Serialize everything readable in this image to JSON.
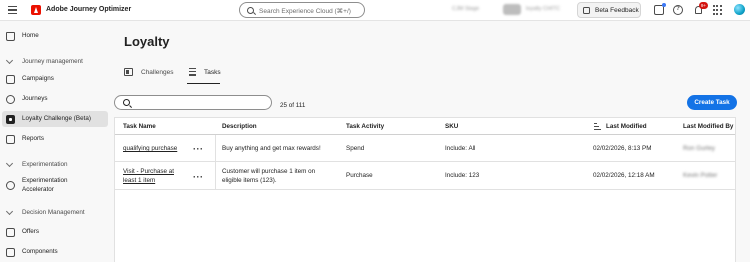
{
  "app": {
    "title": "Adobe Journey Optimizer",
    "search_placeholder": "Search Experience Cloud (⌘+/)",
    "org_sandbox_blurred": "CJM Stage",
    "org_badge_blurred": "Sbx",
    "org_name_blurred": "loyalty CHITC",
    "beta_feedback_label": "Beta Feedback",
    "notification_count": "9+",
    "accent_color": "#1473e6",
    "brand_color": "#eb1000"
  },
  "sidebar": {
    "home": "Home",
    "journey_management": "Journey management",
    "campaigns": "Campaigns",
    "journeys": "Journeys",
    "loyalty_challenge": "Loyalty Challenge (Beta)",
    "reports": "Reports",
    "experimentation": "Experimentation",
    "experimentation_accelerator": "Experimentation Accelerator",
    "decision_management": "Decision Management",
    "offers": "Offers",
    "components": "Components"
  },
  "main": {
    "page_title": "Loyalty",
    "tabs": [
      {
        "label": "Challenges",
        "selected": false
      },
      {
        "label": "Tasks",
        "selected": true
      }
    ],
    "search_value": "",
    "result_count": "25 of 111",
    "create_button": "Create Task"
  },
  "table": {
    "columns": [
      "Task Name",
      "Description",
      "Task Activity",
      "SKU",
      "Last Modified",
      "Last Modified By"
    ],
    "rows": [
      {
        "task_name": "qualifying purchase",
        "description": "Buy anything and get max rewards!",
        "task_activity": "Spend",
        "sku": "Include: All",
        "last_modified": "02/02/2026, 8:13 PM",
        "last_modified_by": "Ron Gurley"
      },
      {
        "task_name": "Visit - Purchase at least 1 item",
        "description": "Customer will purchase 1 item on eligible items (123).",
        "task_activity": "Purchase",
        "sku": "Include: 123",
        "last_modified": "02/02/2026, 12:18 AM",
        "last_modified_by": "Kevin Potter"
      }
    ]
  }
}
